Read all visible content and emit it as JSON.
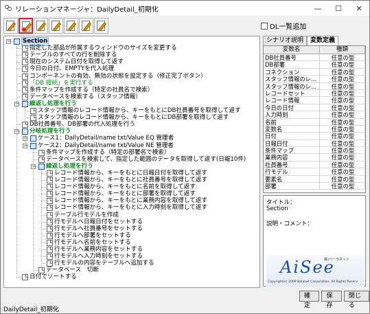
{
  "window": {
    "title": "リレーションマネージャ：DailyDetail_初期化"
  },
  "window_controls": {
    "minimize": "—",
    "maximize": "☐",
    "close": "✕"
  },
  "toolbar": {
    "button_count": 7,
    "active_index": 1
  },
  "dl_checkbox": {
    "label": "DL一覧追加",
    "checked": false
  },
  "tree": {
    "root": "Section",
    "rows": [
      {
        "text": "指定した部品が所属するウィンドウのサイズを変更する"
      },
      {
        "text": "テーブルのすべての行を削除する"
      },
      {
        "text": "現在のシステム日付を取得して返す"
      },
      {
        "text": "今日の日付、EMPTYを代入処理"
      },
      {
        "text": "コンポーネントの有効、無効の状態を設定する（修正完了ボタン）"
      },
      {
        "text": "「DB 接続」を実行する"
      },
      {
        "text": "条件マップを作成する（特定の社員名で検索）"
      },
      {
        "text": "データベースを検索する（スタッフ情報）"
      },
      {
        "text": "繰返し処理を行う"
      },
      {
        "text": "スタッフ情報のレコード情報から、キーをもとにDB社員番号を取得して返す"
      },
      {
        "text": "スタッフ情報のレコード情報から、キーをもとにDB部署を取得して返す"
      },
      {
        "text": "DB社員番号、DB部署の代入処理を行う"
      },
      {
        "text": "分岐処理を行う"
      },
      {
        "text": "ケース1：DailyDetail/name  txt/Value EQ 管理者"
      },
      {
        "text": "ケース2：DailyDetail/name  txt/Value NE 管理者"
      },
      {
        "text": "条件マップを作成する（特定の部署名で検索）"
      },
      {
        "text": "データベースを検索して、指定した範囲のデータを取得して返す(日報10件)"
      },
      {
        "text": "繰返し処理を行う"
      },
      {
        "text": "レコード情報から、キーをもとに日報日付を取得して返す"
      },
      {
        "text": "レコード情報から、キーをもとに社員番号を取得して返す"
      },
      {
        "text": "レコード情報から、キーをもとに名前を取得して返す"
      },
      {
        "text": "レコード情報から、キーをもとに部署を取得して返す"
      },
      {
        "text": "レコード情報から、キーをもとに業務内容を取得して返す"
      },
      {
        "text": "レコード情報から、キーをもとに入力時刻を取得して返す"
      },
      {
        "text": "テーブル行モデルを作成"
      },
      {
        "text": "行モデルへ日報日付をセットする"
      },
      {
        "text": "行モデルへ社員番号をセットする"
      },
      {
        "text": "行モデルへ部署をセットする"
      },
      {
        "text": "行モデルへ名前をセットする"
      },
      {
        "text": "行モデルへ業務内容をセットする"
      },
      {
        "text": "行モデルへ入力時刻をセットする"
      },
      {
        "text": "行モデルの内容をテーブルへ追加する"
      },
      {
        "text": "データベース　切断"
      },
      {
        "text": "日付でソートする"
      }
    ]
  },
  "right_panel": {
    "tabs": [
      "シナリオ説明",
      "変数定義"
    ],
    "active_tab": 1,
    "columns": [
      "変数名",
      "種類"
    ],
    "variables": [
      [
        "DB社員番号",
        "任意の型"
      ],
      [
        "DB部署",
        "任意の型"
      ],
      [
        "コネクション",
        "任意の型"
      ],
      [
        "スタッフ情報のレ...",
        "任意の型"
      ],
      [
        "スタッフ情報のレ...",
        "任意の型"
      ],
      [
        "レコードセット",
        "任意の型"
      ],
      [
        "レコード情報",
        "任意の型"
      ],
      [
        "今日の日付",
        "任意の型"
      ],
      [
        "入力時刻",
        "任意の型"
      ],
      [
        "名前",
        "任意の型"
      ],
      [
        "変数名",
        "任意の型"
      ],
      [
        "日付",
        "任意の型"
      ],
      [
        "日報日付",
        "任意の型"
      ],
      [
        "条件マップ",
        "任意の型"
      ],
      [
        "業務内容",
        "任意の型"
      ],
      [
        "社員番号",
        "任意の型"
      ],
      [
        "行モデル",
        "任意の型"
      ],
      [
        "要素名",
        "任意の型"
      ],
      [
        "部署",
        "任意の型"
      ]
    ],
    "title_label": "タイトル：",
    "title_value": "Section",
    "comment_label": "説明・コメント："
  },
  "logo": {
    "brand": "AiSee",
    "small": "株)ベーラネット",
    "copyright": "Copyright(c) 2009 Belanet Corporation. All Rights Reserv"
  },
  "buttons": {
    "ok": "確定",
    "save": "保存",
    "close": "閉じる"
  },
  "status": {
    "text": "DailyDetail_初期化"
  }
}
